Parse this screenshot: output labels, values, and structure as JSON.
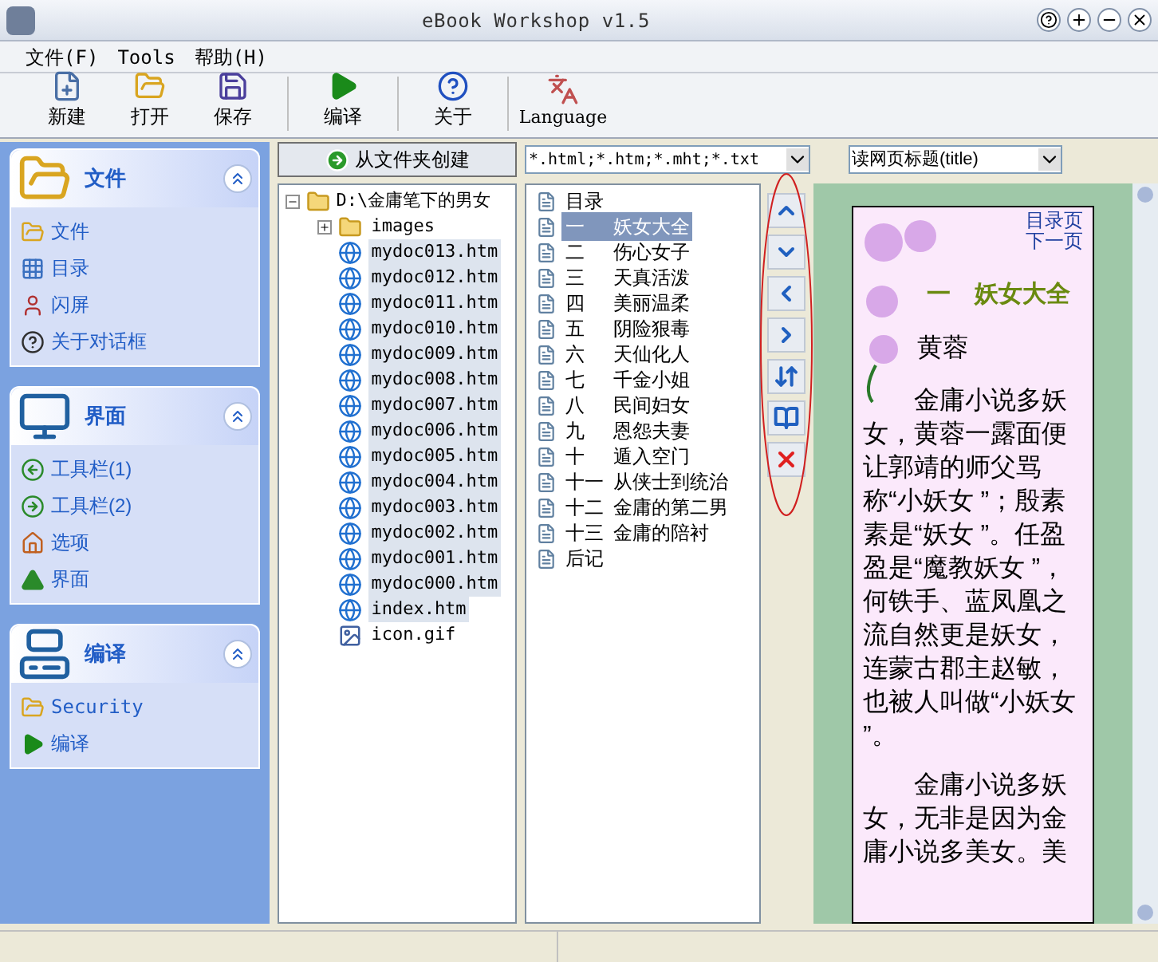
{
  "window": {
    "title": "eBook Workshop v1.5"
  },
  "menu": [
    "文件(F)",
    "Tools",
    "帮助(H)"
  ],
  "toolbar": [
    {
      "label": "新建",
      "kind": "new"
    },
    {
      "label": "打开",
      "kind": "open"
    },
    {
      "label": "保存",
      "kind": "save"
    },
    {
      "label": "编译",
      "kind": "compile"
    },
    {
      "label": "关于",
      "kind": "about"
    },
    {
      "label": "Language",
      "kind": "language"
    }
  ],
  "sidebar": [
    {
      "title": "文件",
      "kind": "folder",
      "expanded": true,
      "items": [
        {
          "label": "文件",
          "kind": "folder"
        },
        {
          "label": "目录",
          "kind": "grid"
        },
        {
          "label": "闪屏",
          "kind": "person"
        },
        {
          "label": "关于对话框",
          "kind": "help"
        }
      ]
    },
    {
      "title": "界面",
      "kind": "monitor",
      "expanded": true,
      "items": [
        {
          "label": "工具栏(1)",
          "kind": "back"
        },
        {
          "label": "工具栏(2)",
          "kind": "forward"
        },
        {
          "label": "选项",
          "kind": "home"
        },
        {
          "label": "界面",
          "kind": "up"
        }
      ]
    },
    {
      "title": "编译",
      "kind": "computer",
      "expanded": true,
      "items": [
        {
          "label": "Security",
          "kind": "folder"
        },
        {
          "label": "编译",
          "kind": "play"
        }
      ]
    }
  ],
  "create_button": "从文件夹创建",
  "file_filter": {
    "value": "*.html;*.htm;*.mht;*.txt"
  },
  "title_source": {
    "value": "读网页标题(title)"
  },
  "file_tree": {
    "label": "D:\\金庸笔下的男女",
    "expanded": true,
    "children": [
      {
        "label": "images",
        "kind": "folder",
        "expanded": false,
        "selected": false
      },
      {
        "label": "mydoc013.htm",
        "kind": "web",
        "selected": true
      },
      {
        "label": "mydoc012.htm",
        "kind": "web",
        "selected": true
      },
      {
        "label": "mydoc011.htm",
        "kind": "web",
        "selected": true
      },
      {
        "label": "mydoc010.htm",
        "kind": "web",
        "selected": true
      },
      {
        "label": "mydoc009.htm",
        "kind": "web",
        "selected": true
      },
      {
        "label": "mydoc008.htm",
        "kind": "web",
        "selected": true
      },
      {
        "label": "mydoc007.htm",
        "kind": "web",
        "selected": true
      },
      {
        "label": "mydoc006.htm",
        "kind": "web",
        "selected": true
      },
      {
        "label": "mydoc005.htm",
        "kind": "web",
        "selected": true
      },
      {
        "label": "mydoc004.htm",
        "kind": "web",
        "selected": true
      },
      {
        "label": "mydoc003.htm",
        "kind": "web",
        "selected": true
      },
      {
        "label": "mydoc002.htm",
        "kind": "web",
        "selected": true
      },
      {
        "label": "mydoc001.htm",
        "kind": "web",
        "selected": true
      },
      {
        "label": "mydoc000.htm",
        "kind": "web",
        "selected": true
      },
      {
        "label": "index.htm",
        "kind": "web",
        "selected": true
      },
      {
        "label": "icon.gif",
        "kind": "image",
        "selected": false
      }
    ]
  },
  "chapters": [
    {
      "num": "目录",
      "selected": false
    },
    {
      "num": "一",
      "title": "妖女大全",
      "selected": true
    },
    {
      "num": "二",
      "title": "伤心女子",
      "selected": false
    },
    {
      "num": "三",
      "title": "天真活泼",
      "selected": false
    },
    {
      "num": "四",
      "title": "美丽温柔",
      "selected": false
    },
    {
      "num": "五",
      "title": "阴险狠毒",
      "selected": false
    },
    {
      "num": "六",
      "title": "天仙化人",
      "selected": false
    },
    {
      "num": "七",
      "title": "千金小姐",
      "selected": false
    },
    {
      "num": "八",
      "title": "民间妇女",
      "selected": false
    },
    {
      "num": "九",
      "title": "恩怨夫妻",
      "selected": false
    },
    {
      "num": "十",
      "title": "遁入空门",
      "selected": false
    },
    {
      "num": "十一",
      "title": "从侠士到统治",
      "selected": false
    },
    {
      "num": "十二",
      "title": "金庸的第二男",
      "selected": false
    },
    {
      "num": "十三",
      "title": "金庸的陪衬",
      "selected": false
    },
    {
      "num": "后记",
      "selected": false
    }
  ],
  "preview": {
    "links": [
      "目录页",
      "下一页"
    ],
    "heading": "一　妖女大全",
    "subheading": "黄蓉",
    "paragraphs": [
      "金庸小说多妖女，黄蓉一露面便让郭靖的师父骂称“小妖女 ”；殷素素是“妖女 ”。任盈盈是“魔教妖女 ”，何铁手、蓝凤凰之流自然更是妖女，连蒙古郡主赵敏，也被人叫做“小妖女 ”。",
      "金庸小说多妖女，无非是因为金庸小说多美女。美"
    ]
  }
}
